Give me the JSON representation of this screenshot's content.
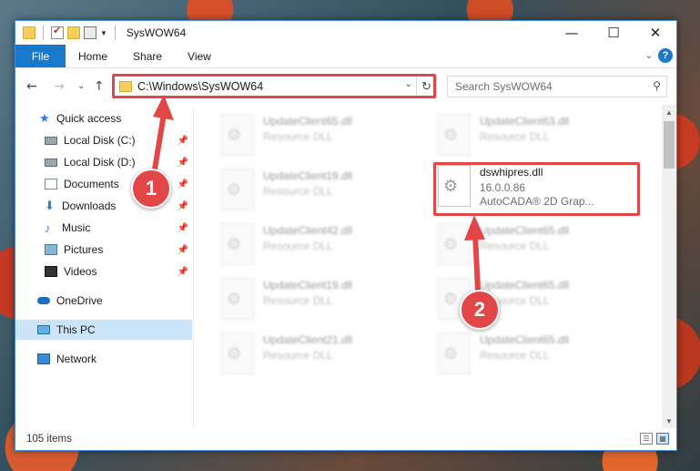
{
  "window": {
    "title": "SysWOW64",
    "controls": {
      "minimize": "—",
      "maximize": "☐",
      "close": "✕"
    }
  },
  "ribbon": {
    "tabs": [
      "File",
      "Home",
      "Share",
      "View"
    ],
    "expand_glyph": "⌄",
    "help_label": "?"
  },
  "navigation": {
    "back_glyph": "←",
    "forward_glyph": "→",
    "recent_glyph": "⌄",
    "up_glyph": "↑"
  },
  "address_bar": {
    "path": "C:\\Windows\\SysWOW64",
    "dropdown_glyph": "⌄",
    "refresh_glyph": "↻"
  },
  "search": {
    "placeholder": "Search SysWOW64",
    "icon_glyph": "⚲"
  },
  "sidebar": {
    "items": [
      {
        "label": "Quick access",
        "icon": "star-icon"
      },
      {
        "label": "Local Disk (C:)",
        "icon": "disk-icon",
        "pinned": true
      },
      {
        "label": "Local Disk (D:)",
        "icon": "disk-icon",
        "pinned": true
      },
      {
        "label": "Documents",
        "icon": "document-icon",
        "pinned": true
      },
      {
        "label": "Downloads",
        "icon": "download-icon",
        "pinned": true
      },
      {
        "label": "Music",
        "icon": "music-icon",
        "pinned": true
      },
      {
        "label": "Pictures",
        "icon": "picture-icon",
        "pinned": true
      },
      {
        "label": "Videos",
        "icon": "video-icon",
        "pinned": true
      },
      {
        "label": "OneDrive",
        "icon": "cloud-icon"
      },
      {
        "label": "This PC",
        "icon": "computer-icon",
        "selected": true
      },
      {
        "label": "Network",
        "icon": "network-icon"
      }
    ],
    "pin_glyph": "📌"
  },
  "files": {
    "left_column": [
      {
        "name": "UpdateClient65.dll",
        "type": "Resource DLL"
      },
      {
        "name": "UpdateClient19.dll",
        "type": "Resource DLL"
      },
      {
        "name": "UpdateClient42.dll",
        "type": "Resource DLL"
      },
      {
        "name": "UpdateClient19.dll",
        "type": "Resource DLL"
      },
      {
        "name": "UpdateClient21.dll",
        "type": "Resource DLL"
      }
    ],
    "right_column": [
      {
        "name": "UpdateClient63.dll",
        "type": "Resource DLL"
      },
      {
        "name": "dswhipres.dll",
        "version": "16.0.0.86",
        "type": "AutoCADA® 2D Grap..."
      },
      {
        "name": "UpdateClient65.dll",
        "type": "Resource DLL"
      },
      {
        "name": "UpdateClient65.dll",
        "type": "Resource DLL"
      },
      {
        "name": "UpdateClient65.dll",
        "type": "Resource DLL"
      }
    ]
  },
  "status": {
    "item_count": "105 items"
  },
  "annotations": {
    "step1": "1",
    "step2": "2",
    "color": "#e24646"
  }
}
